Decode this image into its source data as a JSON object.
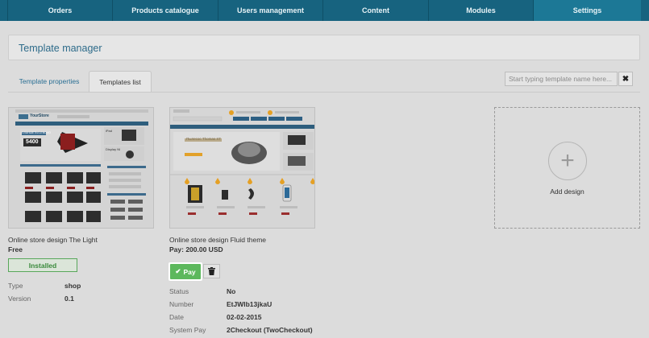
{
  "nav": {
    "tabs": [
      {
        "label": "Orders",
        "active": false
      },
      {
        "label": "Products catalogue",
        "active": false
      },
      {
        "label": "Users management",
        "active": false
      },
      {
        "label": "Content",
        "active": false
      },
      {
        "label": "Modules",
        "active": false
      },
      {
        "label": "Settings",
        "active": true
      }
    ]
  },
  "header": {
    "title": "Template manager"
  },
  "subtabs": {
    "properties": "Template properties",
    "list": "Templates list"
  },
  "search": {
    "placeholder": "Start typing template name here...",
    "value": "",
    "clear_icon": "close-icon"
  },
  "templates": [
    {
      "name": "Online store design The Light",
      "price": "Free",
      "status_badge": "Installed",
      "details": [
        {
          "key": "Type",
          "value": "shop"
        },
        {
          "key": "Version",
          "value": "0.1"
        }
      ],
      "preview": {
        "logo": "YourStore",
        "banner_text": "ПЛАНШЕТЫ LENOVO",
        "banner_price": "5400",
        "side_title": "iPad",
        "side_subtitle": "Display NI"
      }
    },
    {
      "name": "Online store design Fluid theme",
      "price": "Pay: 200.00 USD",
      "pay_label": "Pay",
      "details": [
        {
          "key": "Status",
          "value": "No"
        },
        {
          "key": "Number",
          "value": "EtJWlb13jkaU"
        },
        {
          "key": "Date",
          "value": "02-02-2015"
        },
        {
          "key": "System Pay",
          "value": "2Checkout (TwoCheckout)"
        }
      ],
      "preview": {
        "banner_text": "Пылесос Thomas XT"
      }
    }
  ],
  "add_design": {
    "label": "Add design",
    "icon": "plus-icon"
  },
  "colors": {
    "nav": "#17637f",
    "accent": "#2d6b8a",
    "success": "#5cb85c",
    "overlay": "rgba(0,0,0,0.14)"
  }
}
